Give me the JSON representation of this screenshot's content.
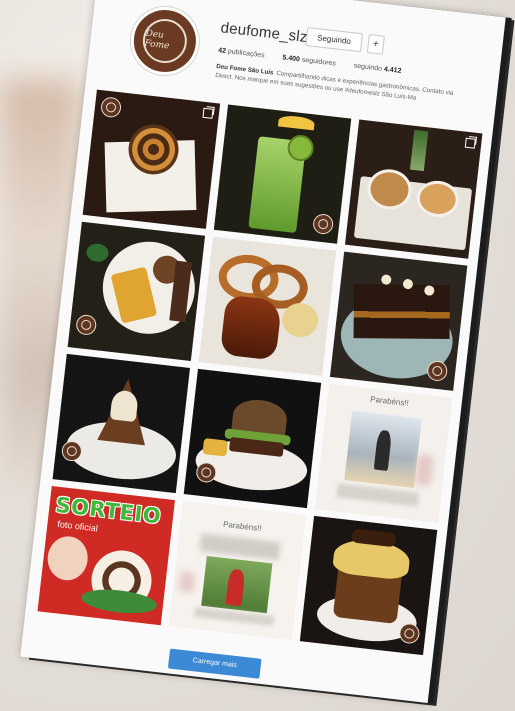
{
  "profile": {
    "username": "deufome_slz",
    "follow_label": "Seguindo",
    "more_label": "+",
    "posts_count": "42",
    "posts_label": "publicações",
    "followers_count": "5.400",
    "followers_label": "seguidores",
    "following_label": "seguindo",
    "following_count": "4.412",
    "bio_name": "Deu Fome São Luís",
    "bio_text": "Compartilhando dicas e experiências gastronômicas. Contato via Direct. Nos marque em suas sugestões ou use #deufomeslz São Luís-Ma",
    "avatar_text": "Deu Fome"
  },
  "posts": [
    {
      "desc": "spiral pastry dessert",
      "bg": "#2a1a12",
      "multi": true
    },
    {
      "desc": "kiwi drink with umbrella",
      "bg": "#1e1e14",
      "multi": false
    },
    {
      "desc": "coffee cups with plant",
      "bg": "#2b1e16",
      "multi": true
    },
    {
      "desc": "steak plate with fries",
      "bg": "#232018",
      "multi": false
    },
    {
      "desc": "onion rings and chicken",
      "bg": "#e9e4dc",
      "multi": false
    },
    {
      "desc": "chocolate cake slice",
      "bg": "#2c2621",
      "multi": false
    },
    {
      "desc": "dessert volcano",
      "bg": "#141414",
      "multi": false
    },
    {
      "desc": "burger on plate",
      "bg": "#111111",
      "multi": false
    },
    {
      "desc": "birthday post person",
      "bg": "#f4f1ec",
      "multi": false
    },
    {
      "desc": "giveaway panettone",
      "bg": "#cf2a24",
      "multi": false
    },
    {
      "desc": "birthday post person 2",
      "bg": "#f6f3ee",
      "multi": false
    },
    {
      "desc": "panettone with cream",
      "bg": "#1a1512",
      "multi": false
    }
  ],
  "overlay_text": {
    "sorteio": "SORTEIO",
    "foto_oficial": "foto oficial",
    "parabens": "Parabéns!!"
  },
  "load_more_label": "Carregar mais",
  "colors": {
    "brand": "#5d3520",
    "button_blue": "#3c8ad6",
    "page_bg": "#fafafa"
  }
}
